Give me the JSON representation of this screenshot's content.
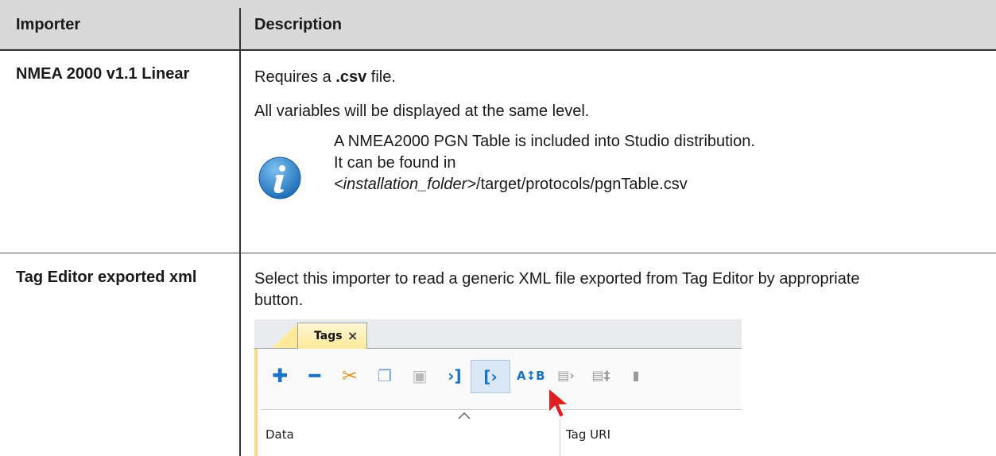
{
  "table": {
    "headers": {
      "importer": "Importer",
      "description": "Description"
    },
    "rows": [
      {
        "importer": "NMEA 2000 v1.1 Linear",
        "desc1_pre": "Requires a ",
        "desc1_bold": ".csv",
        "desc1_post": " file.",
        "desc2": "All variables will be displayed at the same level.",
        "note_line1": "A NMEA2000 PGN Table is included into Studio distribution.",
        "note_line2": "It can be found in",
        "note_line3_italic": "<installation_folder>",
        "note_line3_rest": "/target/protocols/pgnTable.csv"
      },
      {
        "importer": "Tag Editor exported xml",
        "desc1": "Select this importer to read a generic XML file exported from Tag Editor by appropriate button."
      }
    ]
  },
  "tags_panel": {
    "tab_label": "Tags",
    "tab_close": "×",
    "columns": [
      "Data",
      "Tag URI"
    ]
  },
  "colors": {
    "header_bg": "#d9d9d9",
    "info_icon": "#1e6fb8",
    "accent_blue": "#1a73c9",
    "cut_orange": "#e0902a",
    "cursor_red": "#e02020"
  }
}
